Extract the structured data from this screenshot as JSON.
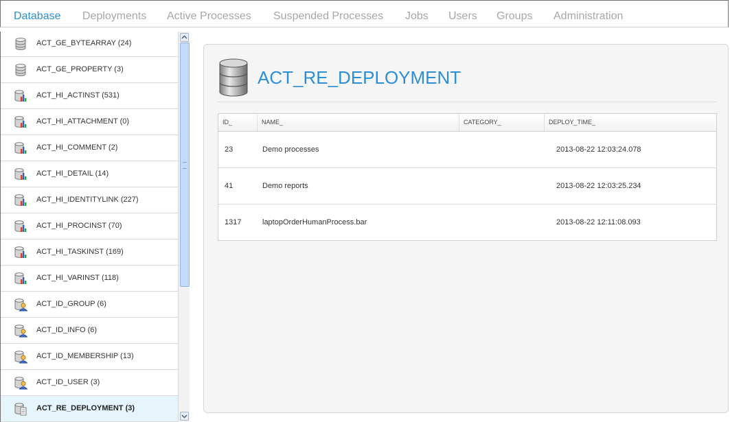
{
  "nav": {
    "tabs": [
      {
        "label": "Database"
      },
      {
        "label": "Deployments"
      },
      {
        "label": "Active Processes"
      },
      {
        "label": "Suspended Processes"
      },
      {
        "label": "Jobs"
      },
      {
        "label": "Users"
      },
      {
        "label": "Groups"
      },
      {
        "label": "Administration"
      }
    ],
    "active_tab": "Database",
    "active_color": "#2c8fd6",
    "inactive_color": "#a7a7a7"
  },
  "sidebar": {
    "items": [
      {
        "label": "ACT_GE_BYTEARRAY (24)",
        "icon": "database-icon"
      },
      {
        "label": "ACT_GE_PROPERTY (3)",
        "icon": "database-icon"
      },
      {
        "label": "ACT_HI_ACTINST (531)",
        "icon": "database-chart-icon"
      },
      {
        "label": "ACT_HI_ATTACHMENT (0)",
        "icon": "database-chart-icon"
      },
      {
        "label": "ACT_HI_COMMENT (2)",
        "icon": "database-chart-icon"
      },
      {
        "label": "ACT_HI_DETAIL (14)",
        "icon": "database-chart-icon"
      },
      {
        "label": "ACT_HI_IDENTITYLINK (227)",
        "icon": "database-chart-icon"
      },
      {
        "label": "ACT_HI_PROCINST (70)",
        "icon": "database-chart-icon"
      },
      {
        "label": "ACT_HI_TASKINST (169)",
        "icon": "database-chart-icon"
      },
      {
        "label": "ACT_HI_VARINST (118)",
        "icon": "database-chart-icon"
      },
      {
        "label": "ACT_ID_GROUP (6)",
        "icon": "database-user-icon"
      },
      {
        "label": "ACT_ID_INFO (6)",
        "icon": "database-user-icon"
      },
      {
        "label": "ACT_ID_MEMBERSHIP (13)",
        "icon": "database-user-icon"
      },
      {
        "label": "ACT_ID_USER (3)",
        "icon": "database-user-icon"
      },
      {
        "label": "ACT_RE_DEPLOYMENT (3)",
        "icon": "database-document-icon",
        "selected": true
      }
    ],
    "selected_bg": "#e6f5fc"
  },
  "main": {
    "title": "ACT_RE_DEPLOYMENT",
    "title_color": "#2c8fd6",
    "table": {
      "columns": [
        "ID_",
        "NAME_",
        "CATEGORY_",
        "DEPLOY_TIME_"
      ],
      "rows": [
        [
          "23",
          "Demo processes",
          "",
          "2013-08-22 12:03:24.078"
        ],
        [
          "41",
          "Demo reports",
          "",
          "2013-08-22 12:03:25.234"
        ],
        [
          "1317",
          "laptopOrderHumanProcess.bar",
          "",
          "2013-08-22 12:11:08.093"
        ]
      ]
    }
  }
}
